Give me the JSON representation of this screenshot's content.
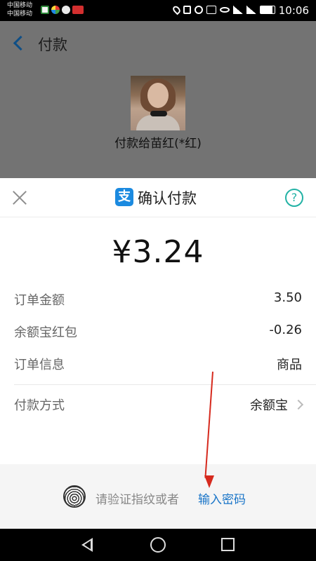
{
  "status_bar": {
    "carrier_line1": "中国移动",
    "carrier_line2": "中国移动",
    "time": "10:06"
  },
  "background_page": {
    "title": "付款",
    "payee": "付款给苗红(*红)"
  },
  "payment_sheet": {
    "title": "确认付款",
    "logo_glyph": "支",
    "help_glyph": "?",
    "amount": "¥3.24",
    "rows": [
      {
        "label": "订单金额",
        "value": "3.50"
      },
      {
        "label": "余额宝红包",
        "value": "-0.26"
      },
      {
        "label": "订单信息",
        "value": "商品"
      },
      {
        "label": "付款方式",
        "value": "余额宝"
      }
    ],
    "verify_prompt": "请验证指纹或者",
    "password_link": "输入密码"
  },
  "colors": {
    "accent_blue": "#1a75c8",
    "alipay_blue": "#1b8ae0",
    "help_teal": "#23b2a5",
    "annotation_red": "#d62a1e"
  },
  "icons": [
    "back-icon",
    "close-icon",
    "alipay-logo",
    "help-icon",
    "chevron-right-icon",
    "fingerprint-icon",
    "nav-back-icon",
    "nav-home-icon",
    "nav-recents-icon"
  ]
}
